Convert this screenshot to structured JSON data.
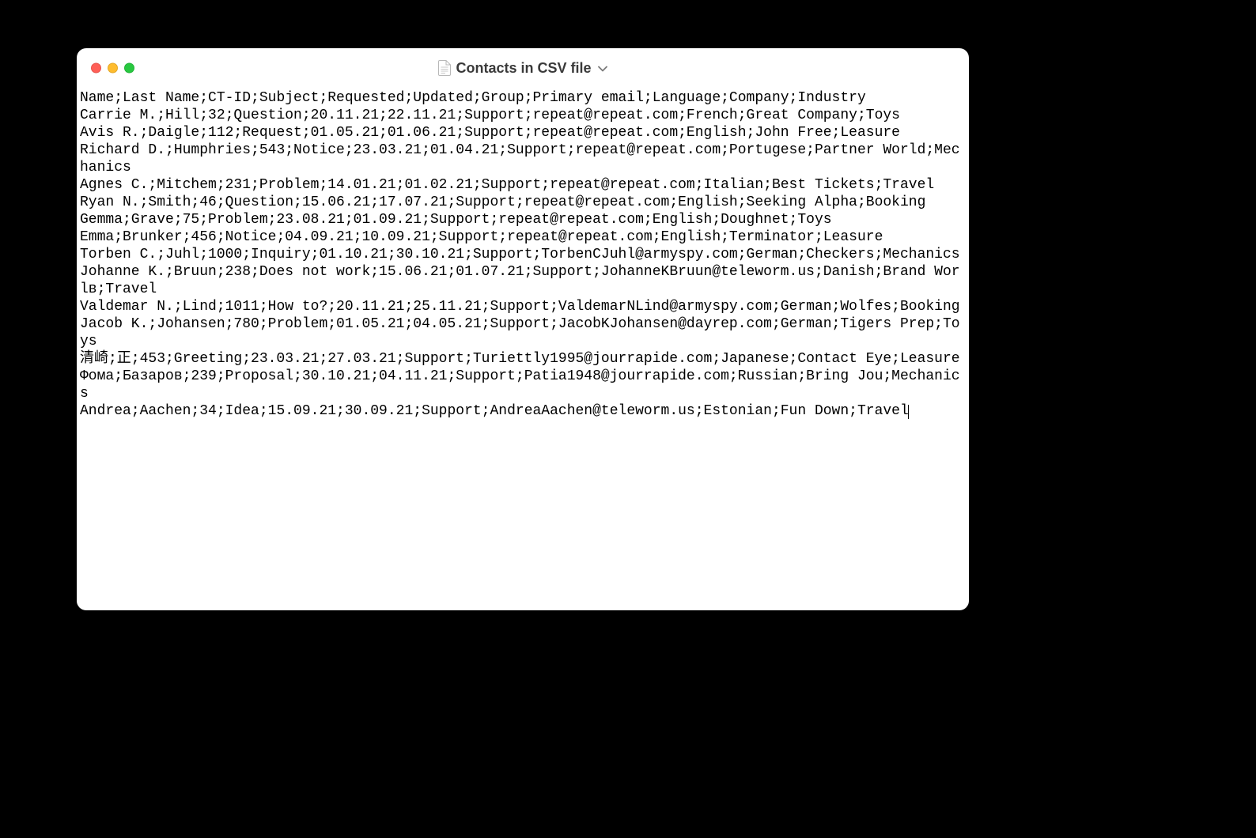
{
  "window": {
    "title": "Contacts in CSV file"
  },
  "csv": {
    "header": "Name;Last Name;CT-ID;Subject;Requested;Updated;Group;Primary email;Language;Company;Industry",
    "rows": [
      "Carrie M.;Hill;32;Question;20.11.21;22.11.21;Support;repeat@repeat.com;French;Great Company;Toys",
      "Avis R.;Daigle;112;Request;01.05.21;01.06.21;Support;repeat@repeat.com;English;John Free;Leasure",
      "Richard D.;Humphries;543;Notice;23.03.21;01.04.21;Support;repeat@repeat.com;Portugese;Partner World;Mechanics",
      "Agnes C.;Mitchem;231;Problem;14.01.21;01.02.21;Support;repeat@repeat.com;Italian;Best Tickets;Travel",
      "Ryan N.;Smith;46;Question;15.06.21;17.07.21;Support;repeat@repeat.com;English;Seeking Alpha;Booking",
      "Gemma;Grave;75;Problem;23.08.21;01.09.21;Support;repeat@repeat.com;English;Doughnet;Toys",
      "Emma;Brunker;456;Notice;04.09.21;10.09.21;Support;repeat@repeat.com;English;Terminator;Leasure",
      "Torben C.;Juhl;1000;Inquiry;01.10.21;30.10.21;Support;TorbenCJuhl@armyspy.com;German;Checkers;Mechanics",
      "Johanne K.;Bruun;238;Does not work;15.06.21;01.07.21;Support;JohanneKBruun@teleworm.us;Danish;Brand Worlв;Travel",
      "Valdemar N.;Lind;1011;How to?;20.11.21;25.11.21;Support;ValdemarNLind@armyspy.com;German;Wolfes;Booking",
      "Jacob K.;Johansen;780;Problem;01.05.21;04.05.21;Support;JacobKJohansen@dayrep.com;German;Tigers Prep;Toys",
      "清崎;正;453;Greeting;23.03.21;27.03.21;Support;Turiettly1995@jourrapide.com;Japanese;Contact Eye;Leasure",
      "Фома;Базаров;239;Proposal;30.10.21;04.11.21;Support;Patia1948@jourrapide.com;Russian;Bring Jou;Mechanics",
      "Andrea;Aachen;34;Idea;15.09.21;30.09.21;Support;AndreaAachen@teleworm.us;Estonian;Fun Down;Travel"
    ]
  }
}
